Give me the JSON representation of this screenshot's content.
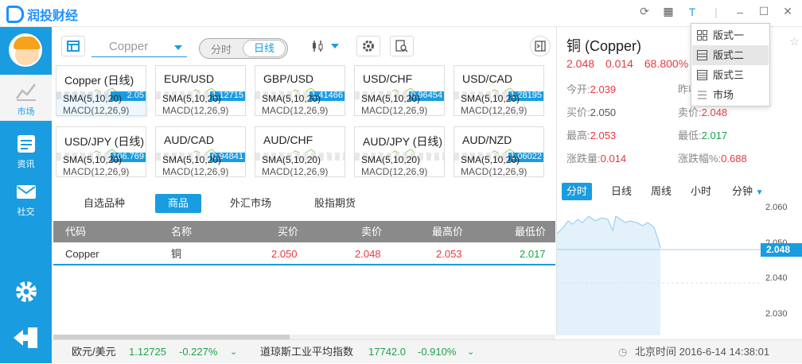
{
  "app": {
    "name": "润投财经"
  },
  "sidebar": {
    "items": [
      {
        "label": "市场",
        "icon": "market-icon",
        "active": true
      },
      {
        "label": "资讯",
        "icon": "news-icon",
        "active": false
      },
      {
        "label": "社交",
        "icon": "mail-icon",
        "active": false
      }
    ]
  },
  "toolbar": {
    "symbol": "Copper",
    "period_options": [
      "分时",
      "日线"
    ],
    "period_selected": "日线"
  },
  "mini_charts": [
    {
      "title": "Copper (日线)",
      "sma": "SMA(5,10,20)",
      "macd": "MACD(12,26,9)",
      "value": "2.05"
    },
    {
      "title": "EUR/USD",
      "sma": "SMA(5,10,20)",
      "macd": "MACD(12,26,9)",
      "value": "1.12715"
    },
    {
      "title": "GBP/USD",
      "sma": "SMA(5,10,20)",
      "macd": "MACD(12,26,9)",
      "value": "1.41466"
    },
    {
      "title": "USD/CHF",
      "sma": "SMA(5,10,20)",
      "macd": "MACD(12,26,9)",
      "value": "0.96454"
    },
    {
      "title": "USD/CAD",
      "sma": "SMA(5,10,20)",
      "macd": "MACD(12,26,9)",
      "value": "1.28195"
    },
    {
      "title": "USD/JPY (日线)",
      "sma": "SMA(5,10,20)",
      "macd": "MACD(12,26,9)",
      "value": "106.769"
    },
    {
      "title": "AUD/CAD",
      "sma": "SMA(5,10,20)",
      "macd": "MACD(12,26,9)",
      "value": "0.94841"
    },
    {
      "title": "AUD/CHF",
      "sma": "SMA(5,10,20)",
      "macd": "MACD(12,26,9)",
      "value": ""
    },
    {
      "title": "AUD/JPY (日线)",
      "sma": "SMA(5,10,20)",
      "macd": "MACD(12,26,9)",
      "value": ""
    },
    {
      "title": "AUD/NZD",
      "sma": "SMA(5,10,20)",
      "macd": "MACD(12,26,9)",
      "value": "1.06022"
    }
  ],
  "category_tabs": [
    {
      "label": "自选品种",
      "active": false
    },
    {
      "label": "商品",
      "active": true
    },
    {
      "label": "外汇市场",
      "active": false
    },
    {
      "label": "股指期货",
      "active": false
    }
  ],
  "quote_table": {
    "columns": [
      "代码",
      "名称",
      "买价",
      "卖价",
      "最高价",
      "最低价"
    ],
    "rows": [
      {
        "code": "Copper",
        "name": "铜",
        "bid": "2.050",
        "ask": "2.048",
        "high": "2.053",
        "low": "2.017"
      }
    ]
  },
  "detail": {
    "name": "铜 (Copper)",
    "price": "2.048",
    "change": "0.014",
    "change_pct": "68.800%",
    "open_label": "今开:",
    "open": "2.039",
    "prev_label": "昨收:",
    "prev": "",
    "bid_label": "买价:",
    "bid": "2.050",
    "ask_label": "卖价:",
    "ask": "2.048",
    "high_label": "最高:",
    "high": "2.053",
    "low_label": "最低:",
    "low": "2.017",
    "chg_label": "涨跌量:",
    "chg": "0.014",
    "chgpct_label": "涨跌幅%:",
    "chgpct": "0.688",
    "tabs": [
      "分时",
      "日线",
      "周线",
      "小时",
      "分钟"
    ],
    "axis": [
      "2.060",
      "2.050",
      "2.040",
      "2.030"
    ],
    "current_tag": "2.048"
  },
  "layout_menu": {
    "items": [
      {
        "label": "版式一",
        "active": false
      },
      {
        "label": "版式二",
        "active": true
      },
      {
        "label": "版式三",
        "active": false
      },
      {
        "label": "市场",
        "active": false
      }
    ]
  },
  "statusbar": {
    "pair1_name": "欧元/美元",
    "pair1_price": "1.12725",
    "pair1_change": "-0.227%",
    "index_name": "道琼斯工业平均指数",
    "index_price": "17742.0",
    "index_change": "-0.910%",
    "clock": "北京时间 2016-6-14 14:38:01"
  },
  "colors": {
    "accent": "#1a9ce0",
    "up": "#e8383d",
    "down": "#1aa34a"
  }
}
